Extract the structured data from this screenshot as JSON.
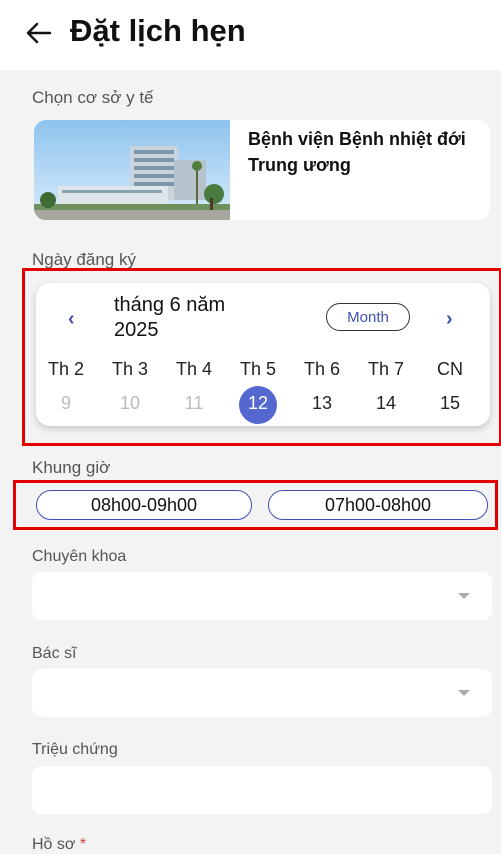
{
  "header": {
    "title": "Đặt lịch hẹn"
  },
  "facility": {
    "label": "Chọn cơ sở y tế",
    "name": "Bệnh viện Bệnh nhiệt đới Trung ương"
  },
  "date": {
    "label": "Ngày đăng ký",
    "month_title": "tháng 6 năm 2025",
    "view_toggle": "Month",
    "prev_icon": "chevron-left",
    "next_icon": "chevron-right",
    "weekdays": [
      "Th 2",
      "Th 3",
      "Th 4",
      "Th 5",
      "Th 6",
      "Th 7",
      "CN"
    ],
    "days": [
      "9",
      "10",
      "11",
      "12",
      "13",
      "14",
      "15"
    ],
    "selected_day": "12",
    "accent": "#5468d0"
  },
  "time": {
    "label": "Khung giờ",
    "slots": [
      "08h00-09h00",
      "07h00-08h00"
    ]
  },
  "specialty": {
    "label": "Chuyên khoa",
    "value": ""
  },
  "doctor": {
    "label": "Bác sĩ",
    "value": ""
  },
  "symptoms": {
    "label": "Triệu chứng",
    "value": ""
  },
  "profile": {
    "label": "Hồ sơ",
    "required_mark": "*"
  },
  "colors": {
    "highlight": "#e30000",
    "primary": "#3f51b5"
  }
}
